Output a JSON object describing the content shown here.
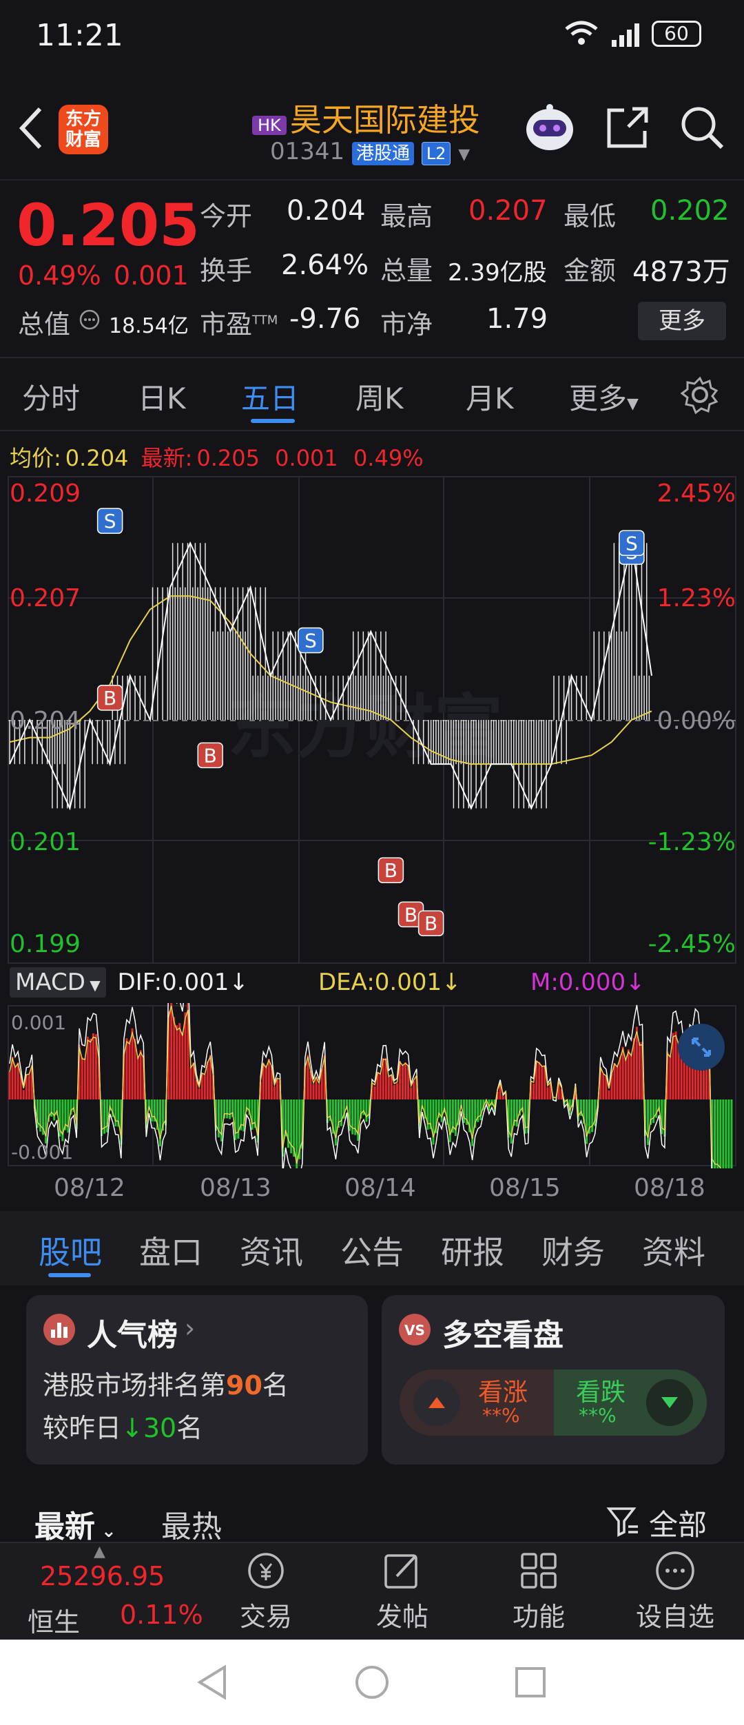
{
  "status": {
    "time": "11:21",
    "battery": "60",
    "signal_label": "6"
  },
  "header": {
    "logo_line1": "东方",
    "logo_line2": "财富",
    "market_badge": "HK",
    "stock_name": "昊天国际建投",
    "code": "01341",
    "connect_tag": "港股通",
    "level_tag": "L2"
  },
  "quote": {
    "price": "0.205",
    "change_pct": "0.49%",
    "change": "0.001",
    "open_label": "今开",
    "open": "0.204",
    "high_label": "最高",
    "high": "0.207",
    "low_label": "最低",
    "low": "0.202",
    "turnover_label": "换手",
    "turnover": "2.64%",
    "volume_label": "总量",
    "volume": "2.39亿股",
    "amount_label": "金额",
    "amount": "4873万",
    "mcap_label": "总值",
    "mcap": "18.54亿",
    "pe_label": "市盈",
    "pe_sup": "TTM",
    "pe": "-9.76",
    "pb_label": "市净",
    "pb": "1.79",
    "more": "更多"
  },
  "tabs": [
    "分时",
    "日K",
    "五日",
    "周K",
    "月K",
    "更多"
  ],
  "active_tab": 2,
  "chart_info": {
    "avg_label": "均价:",
    "avg": "0.204",
    "latest_label": "最新:",
    "latest": "0.205",
    "chg": "0.001",
    "chg_pct": "0.49%"
  },
  "chart_data": {
    "type": "line",
    "y_left_ticks": [
      "0.209",
      "0.207",
      "0.204",
      "0.201",
      "0.199"
    ],
    "y_right_ticks": [
      "2.45%",
      "1.23%",
      "0.00%",
      "-1.23%",
      "-2.45%"
    ],
    "x_labels": [
      "08/12",
      "08/13",
      "08/14",
      "08/15",
      "08/18"
    ],
    "watermark": "东方财富",
    "price_series": [
      0.203,
      0.204,
      0.203,
      0.202,
      0.204,
      0.203,
      0.205,
      0.204,
      0.207,
      0.208,
      0.207,
      0.206,
      0.207,
      0.205,
      0.206,
      0.205,
      0.204,
      0.205,
      0.206,
      0.205,
      0.204,
      0.203,
      0.203,
      0.202,
      0.203,
      0.203,
      0.202,
      0.203,
      0.205,
      0.204,
      0.206,
      0.208,
      0.205
    ],
    "avg_series": [
      0.2035,
      0.2036,
      0.2036,
      0.2038,
      0.2042,
      0.2048,
      0.2058,
      0.2065,
      0.2068,
      0.2068,
      0.2067,
      0.2062,
      0.2055,
      0.205,
      0.2048,
      0.2046,
      0.2044,
      0.2043,
      0.2042,
      0.204,
      0.2036,
      0.2033,
      0.2031,
      0.203,
      0.203,
      0.203,
      0.203,
      0.203,
      0.2031,
      0.2032,
      0.2035,
      0.204,
      0.2042
    ],
    "markers": [
      "S",
      "B",
      "B",
      "S",
      "B",
      "B",
      "B",
      "S",
      "S"
    ],
    "macd": {
      "name": "MACD",
      "dif": "DIF:0.001",
      "dea": "DEA:0.001",
      "m": "M:0.000",
      "top": "0.001",
      "bottom": "-0.001"
    }
  },
  "bottom_tabs": [
    "股吧",
    "盘口",
    "资讯",
    "公告",
    "研报",
    "财务",
    "资料"
  ],
  "popularity": {
    "title": "人气榜",
    "line1_prefix": "港股市场排名第",
    "rank": "90",
    "line1_suffix": "名",
    "line2_prefix": "较昨日",
    "delta": "30",
    "line2_suffix": "名"
  },
  "sentiment": {
    "title": "多空看盘",
    "bull": "看涨",
    "bull_pct": "**%",
    "bear": "看跌",
    "bear_pct": "**%"
  },
  "feed": {
    "latest": "最新",
    "hot": "最热",
    "filter": "全部"
  },
  "bottom_bar": {
    "index_value": "25296.95",
    "index_name": "恒生",
    "index_pct": "0.11%",
    "trade": "交易",
    "post": "发帖",
    "func": "功能",
    "watch": "设自选"
  },
  "colors": {
    "up": "#f0262b",
    "down": "#21c12b",
    "accent": "#3d8ef0",
    "avg_line": "#e8d24a"
  }
}
